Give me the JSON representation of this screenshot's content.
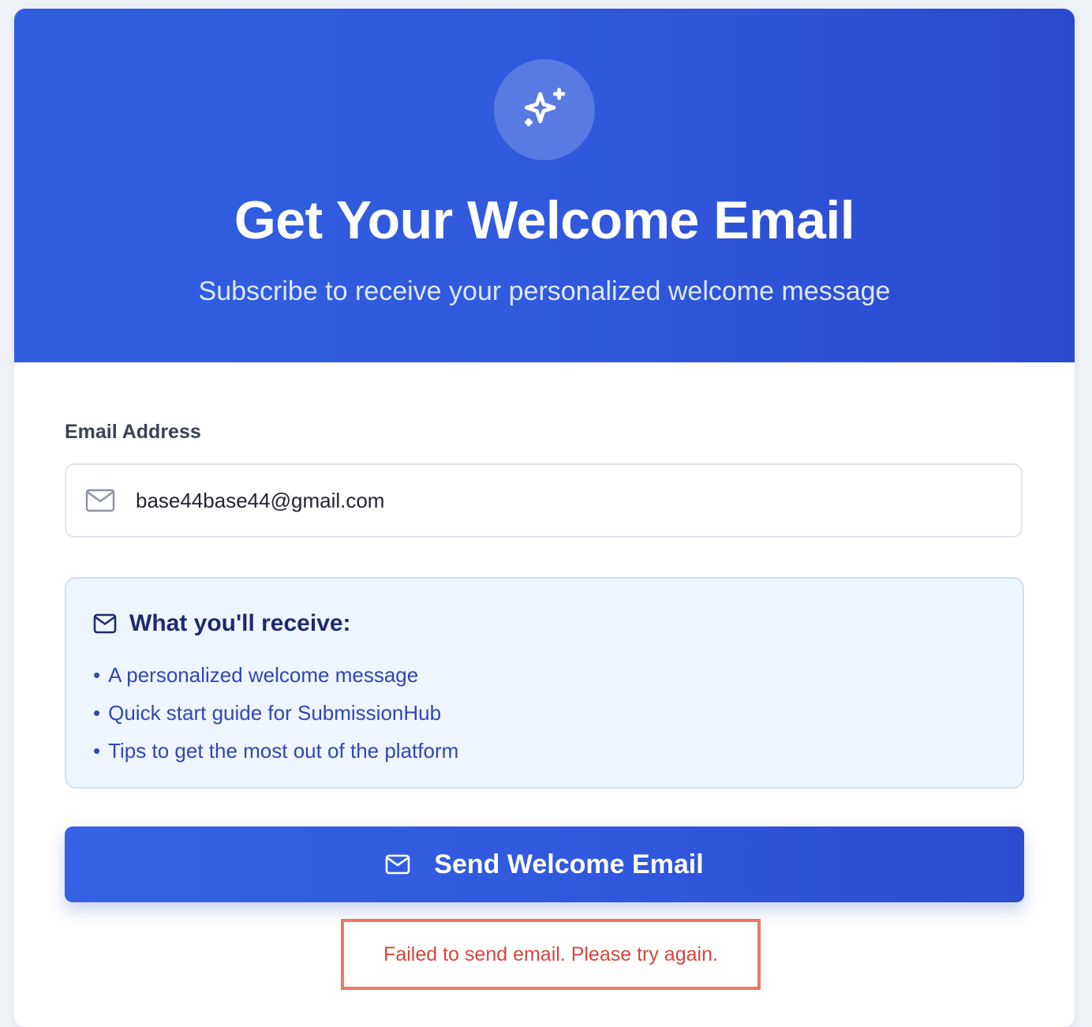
{
  "hero": {
    "icon": "sparkles-icon",
    "title": "Get Your Welcome Email",
    "subtitle": "Subscribe to receive your personalized welcome message"
  },
  "form": {
    "email_label": "Email Address",
    "email_value": "base44base44@gmail.com",
    "email_icon": "mail-icon"
  },
  "info": {
    "title": "What you'll receive:",
    "icon": "mail-icon",
    "items": [
      "A personalized welcome message",
      "Quick start guide for SubmissionHub",
      "Tips to get the most out of the platform"
    ]
  },
  "button": {
    "label": "Send Welcome Email",
    "icon": "mail-icon"
  },
  "error": {
    "message": "Failed to send email. Please try again."
  },
  "colors": {
    "primary": "#3159dd",
    "info_bg": "#eef5fe",
    "info_text": "#2f47b8",
    "error": "#d8453c",
    "error_border": "#ec7a62"
  }
}
